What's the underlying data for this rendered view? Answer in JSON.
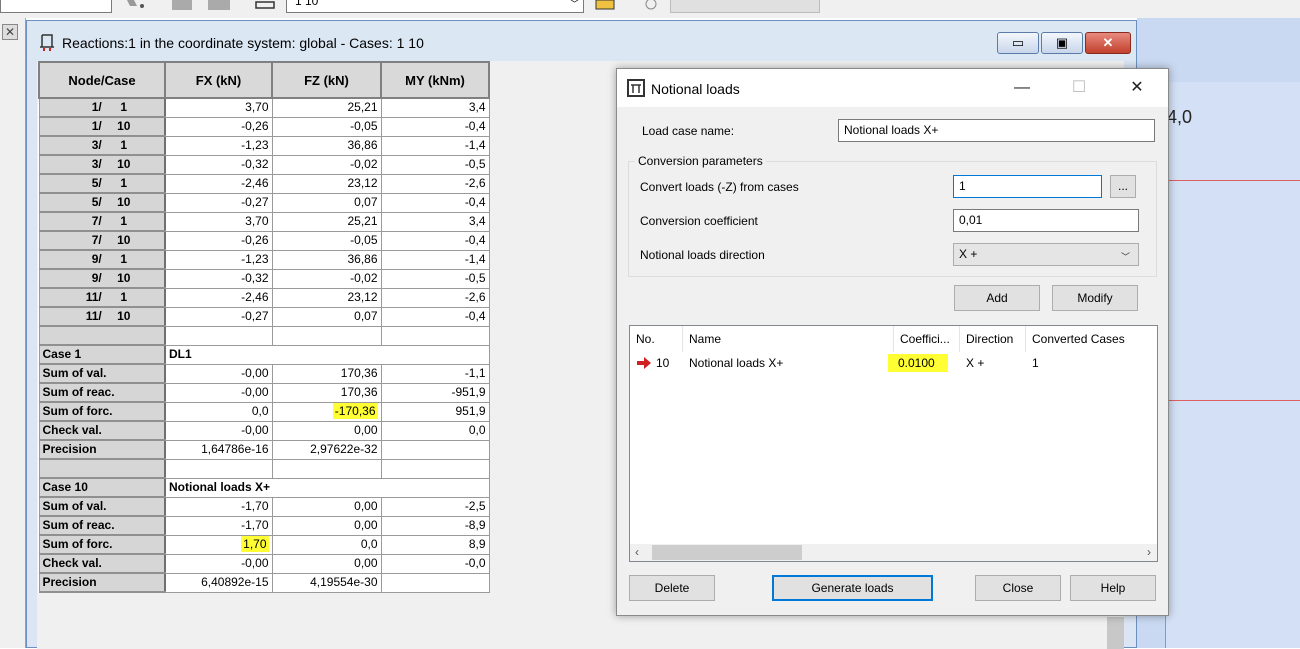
{
  "toolbar": {
    "case_combo_value": "1 10"
  },
  "background_view": {
    "axis_value": "4,0"
  },
  "reactions_window": {
    "title": "Reactions:1 in the coordinate system: global - Cases:  1 10",
    "buttons": {
      "minimize": "▭",
      "maximize": "▣",
      "close": "✕"
    },
    "columns": [
      "Node/Case",
      "FX (kN)",
      "FZ (kN)",
      "MY (kNm)"
    ],
    "node_rows": [
      {
        "node": "1/",
        "case": "1",
        "fx": "3,70",
        "fz": "25,21",
        "my": "3,4"
      },
      {
        "node": "1/",
        "case": "10",
        "fx": "-0,26",
        "fz": "-0,05",
        "my": "-0,4"
      },
      {
        "node": "3/",
        "case": "1",
        "fx": "-1,23",
        "fz": "36,86",
        "my": "-1,4"
      },
      {
        "node": "3/",
        "case": "10",
        "fx": "-0,32",
        "fz": "-0,02",
        "my": "-0,5"
      },
      {
        "node": "5/",
        "case": "1",
        "fx": "-2,46",
        "fz": "23,12",
        "my": "-2,6"
      },
      {
        "node": "5/",
        "case": "10",
        "fx": "-0,27",
        "fz": "0,07",
        "my": "-0,4"
      },
      {
        "node": "7/",
        "case": "1",
        "fx": "3,70",
        "fz": "25,21",
        "my": "3,4"
      },
      {
        "node": "7/",
        "case": "10",
        "fx": "-0,26",
        "fz": "-0,05",
        "my": "-0,4"
      },
      {
        "node": "9/",
        "case": "1",
        "fx": "-1,23",
        "fz": "36,86",
        "my": "-1,4"
      },
      {
        "node": "9/",
        "case": "10",
        "fx": "-0,32",
        "fz": "-0,02",
        "my": "-0,5"
      },
      {
        "node": "11/",
        "case": "1",
        "fx": "-2,46",
        "fz": "23,12",
        "my": "-2,6"
      },
      {
        "node": "11/",
        "case": "10",
        "fx": "-0,27",
        "fz": "0,07",
        "my": "-0,4"
      }
    ],
    "case1": {
      "label": "Case 1",
      "name": "DL1",
      "rows": [
        {
          "label": "Sum of val.",
          "fx": "-0,00",
          "fz": "170,36",
          "my": "-1,1"
        },
        {
          "label": "Sum of reac.",
          "fx": "-0,00",
          "fz": "170,36",
          "my": "-951,9"
        },
        {
          "label": "Sum of forc.",
          "fx": "0,0",
          "fz": "-170,36",
          "my": "951,9"
        },
        {
          "label": "Check val.",
          "fx": "-0,00",
          "fz": "0,00",
          "my": "0,0"
        },
        {
          "label": "Precision",
          "fx": "1,64786e-16",
          "fz": "2,97622e-32",
          "my": ""
        }
      ]
    },
    "case10": {
      "label": "Case 10",
      "name": "Notional loads X+",
      "rows": [
        {
          "label": "Sum of val.",
          "fx": "-1,70",
          "fz": "0,00",
          "my": "-2,5"
        },
        {
          "label": "Sum of reac.",
          "fx": "-1,70",
          "fz": "0,00",
          "my": "-8,9"
        },
        {
          "label": "Sum of forc.",
          "fx": "1,70",
          "fz": "0,0",
          "my": "8,9"
        },
        {
          "label": "Check val.",
          "fx": "-0,00",
          "fz": "0,00",
          "my": "-0,0"
        },
        {
          "label": "Precision",
          "fx": "6,40892e-15",
          "fz": "4,19554e-30",
          "my": ""
        }
      ]
    }
  },
  "dialog": {
    "title": "Notional loads",
    "caption_buttons": {
      "minimize": "—",
      "maximize": "☐",
      "close": "✕"
    },
    "load_case_name_label": "Load case name:",
    "load_case_name_value": "Notional loads X+",
    "group_title": "Conversion parameters",
    "convert_label": "Convert loads (-Z) from cases",
    "convert_value": "1",
    "browse_label": "...",
    "coefficient_label": "Conversion coefficient",
    "coefficient_value": "0,01",
    "direction_label": "Notional loads direction",
    "direction_value": "X +",
    "add_label": "Add",
    "modify_label": "Modify",
    "list": {
      "headers": [
        "No.",
        "Name",
        "Coeffici...",
        "Direction",
        "Converted Cases"
      ],
      "rows": [
        {
          "no": "10",
          "name": "Notional loads X+",
          "coef": "0.0100",
          "direction": "X +",
          "cases": "1"
        }
      ]
    },
    "delete_label": "Delete",
    "generate_label": "Generate loads",
    "close_label": "Close",
    "help_label": "Help"
  },
  "colors": {
    "highlight": "#ffff33",
    "accent": "#0078d7",
    "arrow": "#d02020"
  }
}
